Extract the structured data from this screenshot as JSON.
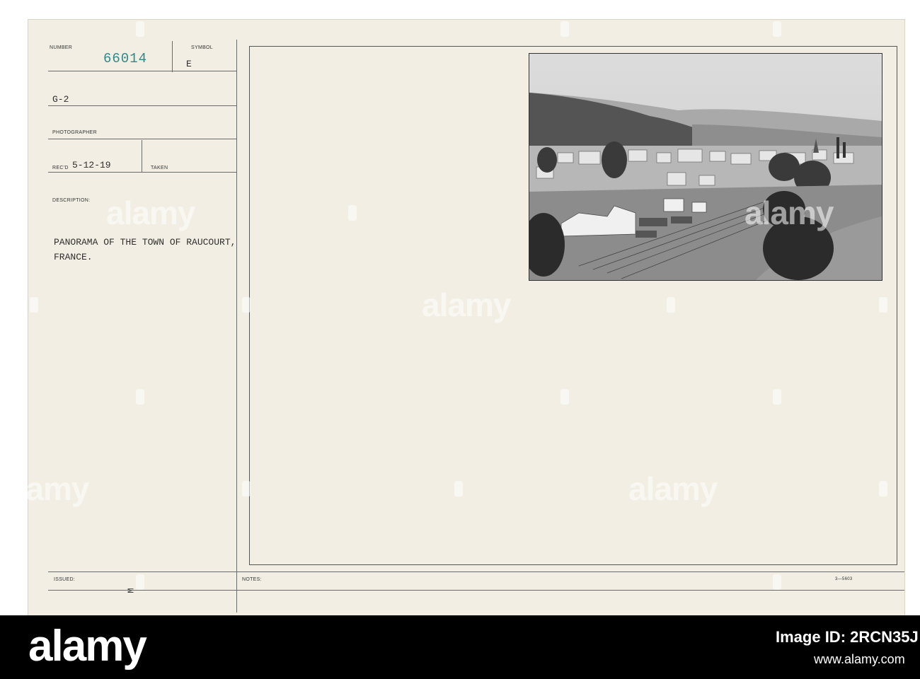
{
  "card": {
    "number_label": "NUMBER",
    "number_value": "66014",
    "symbol_label": "SYMBOL",
    "symbol_value": "E",
    "unit": "G-2",
    "photographer_label": "PHOTOGRAPHER",
    "recd_label": "REC'D",
    "recd_value": "5-12-19",
    "taken_label": "TAKEN",
    "description_label": "DESCRIPTION:",
    "description_line1": "PANORAMA OF THE TOWN OF RAUCOURT,",
    "description_line2": "FRANCE.",
    "issued_label": "ISSUED:",
    "issued_mark": "M",
    "notes_label": "NOTES:",
    "form_number": "3—5603"
  },
  "watermark": {
    "text": "alamy"
  },
  "footer": {
    "logo": "alamy",
    "image_id_label": "Image ID: 2RCN35J",
    "site": "www.alamy.com"
  },
  "colors": {
    "card_background": "#f2eee3",
    "stamp_teal": "#2d8a8c",
    "band_black": "#000000"
  }
}
